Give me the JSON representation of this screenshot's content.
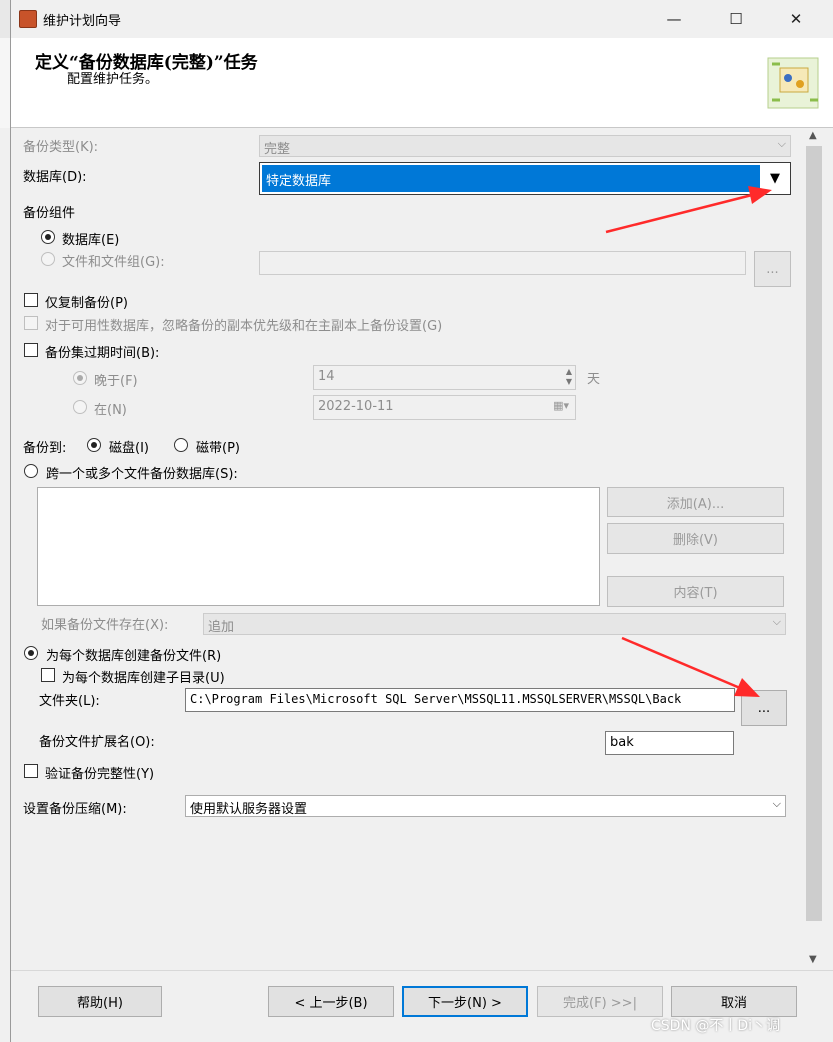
{
  "window": {
    "title": "维护计划向导",
    "minimize": "—",
    "maximize": "☐",
    "close": "✕"
  },
  "header": {
    "title": "定义“备份数据库(完整)”任务",
    "subtitle": "配置维护任务。"
  },
  "backup_type": {
    "label": "备份类型(K):",
    "value": "完整"
  },
  "database": {
    "label": "数据库(D):",
    "value": "特定数据库"
  },
  "components": {
    "label": "备份组件",
    "db_option": "数据库(E)",
    "files_option": "文件和文件组(G):",
    "browse": "..."
  },
  "copy_only": {
    "label": "仅复制备份(P)"
  },
  "ignore_replica": {
    "label": "对于可用性数据库，忽略备份的副本优先级和在主副本上备份设置(G)"
  },
  "expire": {
    "label": "备份集过期时间(B):",
    "after_label": "晚于(F)",
    "after_value": "14",
    "unit": "天",
    "on_label": "在(N)",
    "on_value": "2022-10-11"
  },
  "backup_to": {
    "label": "备份到:",
    "disk": "磁盘(I)",
    "tape": "磁带(P)"
  },
  "span": {
    "label": "跨一个或多个文件备份数据库(S):",
    "add": "添加(A)...",
    "remove": "删除(V)",
    "contents": "内容(T)"
  },
  "if_exists": {
    "label": "如果备份文件存在(X):",
    "value": "追加"
  },
  "per_db": {
    "label": "为每个数据库创建备份文件(R)",
    "subdir": "为每个数据库创建子目录(U)",
    "folder_label": "文件夹(L):",
    "folder_value": "C:\\Program Files\\Microsoft SQL Server\\MSSQL11.MSSQLSERVER\\MSSQL\\Back",
    "browse": "..."
  },
  "extension": {
    "label": "备份文件扩展名(O):",
    "value": "bak"
  },
  "verify": {
    "label": "验证备份完整性(Y)"
  },
  "compression": {
    "label": "设置备份压缩(M):",
    "value": "使用默认服务器设置"
  },
  "footer": {
    "help": "帮助(H)",
    "back": "< 上一步(B)",
    "next": "下一步(N) >",
    "finish": "完成(F) >>|",
    "cancel": "取消"
  },
  "watermark": "CSDN @不丨Di丶调",
  "colors": {
    "accent": "#0078d7",
    "arrow": "#ff2a2a"
  }
}
